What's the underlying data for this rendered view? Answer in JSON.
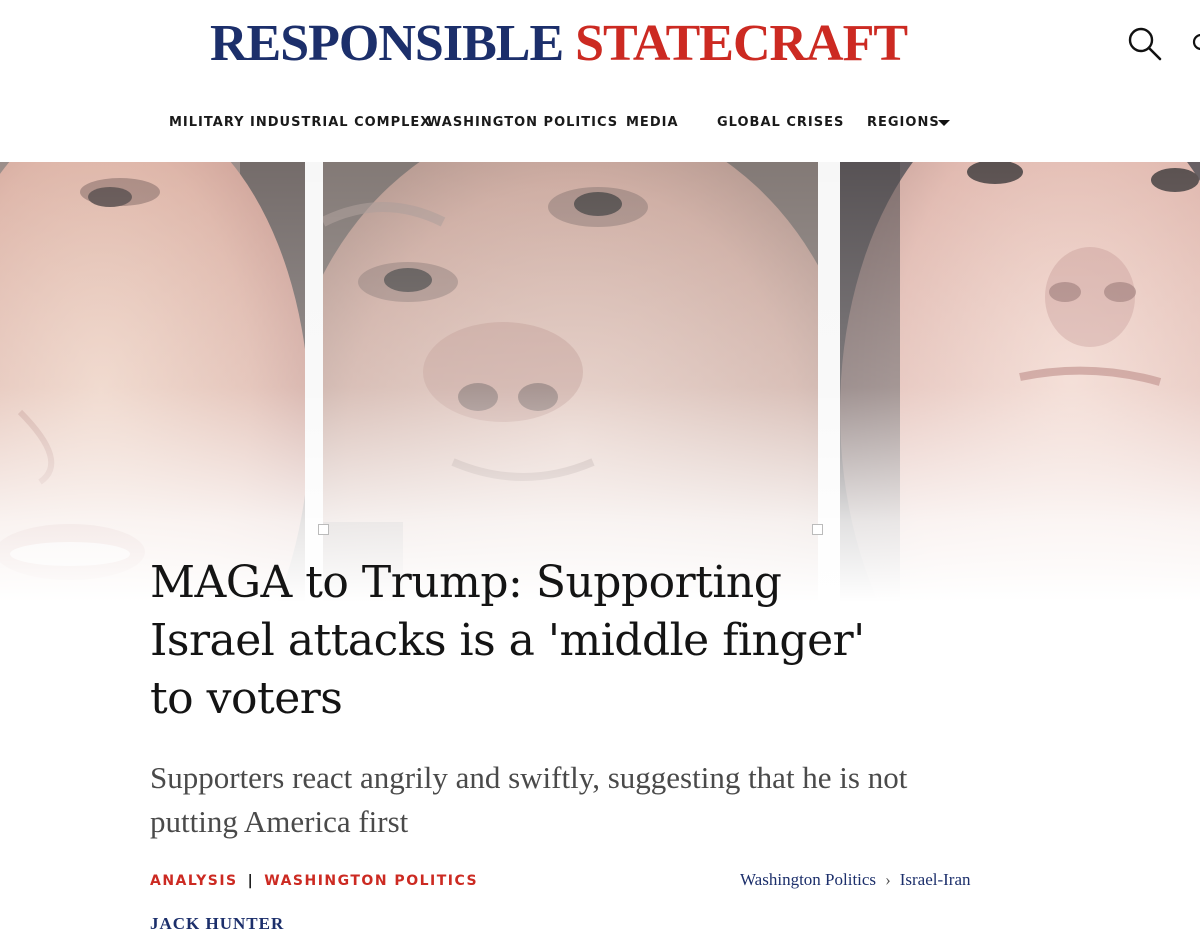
{
  "site": {
    "logo_part1": "RESPONSIBLE",
    "logo_part2": "STATECRAFT"
  },
  "nav": {
    "items": [
      {
        "label": "MILITARY INDUSTRIAL COMPLEX"
      },
      {
        "label": "WASHINGTON POLITICS"
      },
      {
        "label": "MEDIA"
      },
      {
        "label": "GLOBAL CRISES"
      },
      {
        "label": "REGIONS"
      }
    ]
  },
  "article": {
    "headline": "MAGA to Trump: Supporting Israel attacks is a 'middle finger' to voters",
    "subheadline": "Supporters react angrily and swiftly, suggesting that he is not putting America first",
    "category_type": "ANALYSIS",
    "category_separator": "|",
    "category_section": "WASHINGTON POLITICS",
    "breadcrumbs": [
      "Washington Politics",
      "Israel-Iran"
    ],
    "breadcrumb_separator": "›",
    "author": "JACK HUNTER"
  },
  "icons": {
    "search": "search-icon",
    "extra": "partial-icon"
  },
  "colors": {
    "brand_navy": "#1c2f6b",
    "brand_red": "#cc2a22"
  }
}
